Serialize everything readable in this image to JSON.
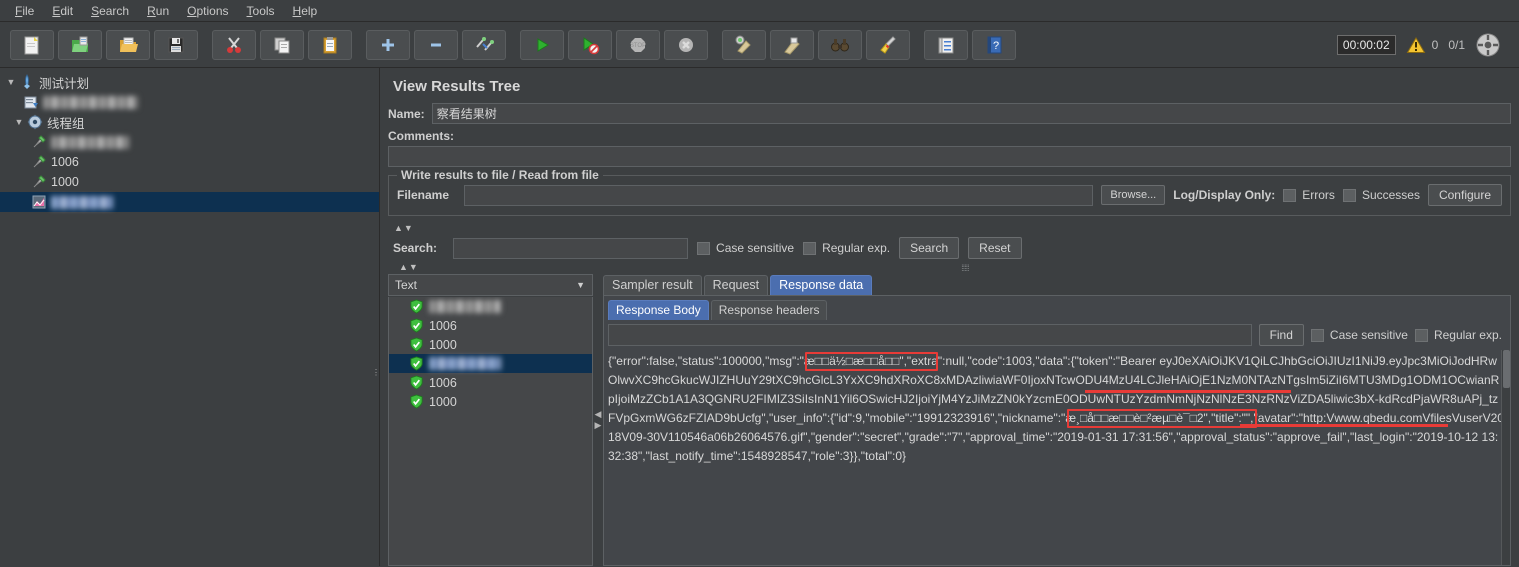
{
  "menu": {
    "items": [
      {
        "label": "File",
        "mnemonic": "F"
      },
      {
        "label": "Edit",
        "mnemonic": "E"
      },
      {
        "label": "Search",
        "mnemonic": "S"
      },
      {
        "label": "Run",
        "mnemonic": "R"
      },
      {
        "label": "Options",
        "mnemonic": "O"
      },
      {
        "label": "Tools",
        "mnemonic": "T"
      },
      {
        "label": "Help",
        "mnemonic": "H"
      }
    ]
  },
  "toolbar": {
    "buttons": [
      {
        "name": "new-test-plan-icon",
        "title": "New"
      },
      {
        "name": "templates-icon",
        "title": "Templates"
      },
      {
        "name": "open-folder-icon",
        "title": "Open"
      },
      {
        "name": "save-icon",
        "title": "Save"
      },
      {
        "name": "cut-scissors-icon",
        "title": "Cut"
      },
      {
        "name": "copy-icon",
        "title": "Copy"
      },
      {
        "name": "paste-clipboard-icon",
        "title": "Paste"
      },
      {
        "name": "expand-all-plus-icon",
        "title": "Expand all"
      },
      {
        "name": "collapse-all-minus-icon",
        "title": "Collapse all"
      },
      {
        "name": "toggle-icon",
        "title": "Toggle"
      },
      {
        "name": "start-play-icon",
        "title": "Start"
      },
      {
        "name": "start-no-pauses-icon",
        "title": "Start no pauses"
      },
      {
        "name": "stop-icon",
        "title": "Stop"
      },
      {
        "name": "shutdown-icon",
        "title": "Shutdown"
      },
      {
        "name": "clear-icon",
        "title": "Clear"
      },
      {
        "name": "clear-all-icon",
        "title": "Clear all"
      },
      {
        "name": "search-binoculars-icon",
        "title": "Search"
      },
      {
        "name": "reset-search-broom-icon",
        "title": "Reset Search"
      },
      {
        "name": "function-helper-icon",
        "title": "Function Helper Dialog"
      },
      {
        "name": "help-book-icon",
        "title": "Help"
      }
    ],
    "elapsed_time": "00:00:02",
    "warning_count": "0",
    "threads_running": "0/1"
  },
  "tree": {
    "items": [
      {
        "label": "测试计划",
        "icon": "test-plan-icon",
        "indent": 0,
        "toggle": "▼",
        "blurred": false,
        "selected": false
      },
      {
        "label": "",
        "icon": "http-header-manager-icon",
        "indent": 1,
        "toggle": "",
        "blurred": true,
        "blur_width": 95,
        "selected": false
      },
      {
        "label": "线程组",
        "icon": "thread-group-icon",
        "indent": 0,
        "toggle": "▼",
        "blurred": false,
        "selected": false
      },
      {
        "label": "",
        "icon": "http-sampler-icon",
        "indent": 1,
        "toggle": "",
        "blurred": true,
        "blur_width": 80,
        "selected": false
      },
      {
        "label": "1006",
        "icon": "http-sampler-icon",
        "indent": 1,
        "toggle": "",
        "blurred": false,
        "selected": false
      },
      {
        "label": "1000",
        "icon": "http-sampler-icon",
        "indent": 1,
        "toggle": "",
        "blurred": false,
        "selected": false
      },
      {
        "label": "",
        "icon": "view-results-tree-icon",
        "indent": 1,
        "toggle": "",
        "blurred": true,
        "blur_width": 62,
        "selected": true
      }
    ]
  },
  "panel": {
    "title": "View Results Tree",
    "name_label": "Name:",
    "name_value": "察看结果树",
    "comments_label": "Comments:",
    "comments_value": "",
    "file_group_title": "Write results to file / Read from file",
    "filename_label": "Filename",
    "filename_value": "",
    "browse_label": "Browse...",
    "log_display_only_label": "Log/Display Only:",
    "errors_label": "Errors",
    "errors_checked": false,
    "successes_label": "Successes",
    "successes_checked": false,
    "configure_label": "Configure"
  },
  "search": {
    "label": "Search:",
    "value": "",
    "case_sensitive_label": "Case sensitive",
    "case_sensitive_checked": false,
    "regular_exp_label": "Regular exp.",
    "regular_exp_checked": false,
    "search_button": "Search",
    "reset_button": "Reset"
  },
  "results": {
    "render_selector_value": "Text",
    "render_selector_arrow": "▼",
    "rows": [
      {
        "label": "",
        "blurred": true,
        "blur_width": 72,
        "status": "success",
        "selected": false
      },
      {
        "label": "1006",
        "blurred": false,
        "status": "success",
        "selected": false
      },
      {
        "label": "1000",
        "blurred": false,
        "status": "success",
        "selected": false
      },
      {
        "label": "",
        "blurred": true,
        "blur_width": 72,
        "status": "success",
        "selected": true
      },
      {
        "label": "1006",
        "blurred": false,
        "status": "success",
        "selected": false
      },
      {
        "label": "1000",
        "blurred": false,
        "status": "success",
        "selected": false
      }
    ]
  },
  "tabs": {
    "main": [
      {
        "label": "Sampler result",
        "active": false
      },
      {
        "label": "Request",
        "active": false
      },
      {
        "label": "Response data",
        "active": true
      }
    ],
    "sub": [
      {
        "label": "Response Body",
        "active": true
      },
      {
        "label": "Response headers",
        "active": false
      }
    ]
  },
  "find": {
    "value": "",
    "find_button": "Find",
    "case_sensitive_label": "Case sensitive",
    "case_sensitive_checked": false,
    "regular_exp_label": "Regular exp.",
    "regular_exp_checked": false
  },
  "response": {
    "body": "{\"error\":false,\"status\":100000,\"msg\":\"æ□□ä½□æ□□å□□\",\"extra\":null,\"code\":1003,\"data\":{\"token\":\"Bearer eyJ0eXAiOiJKV1QiLCJhbGciOiJIUzI1NiJ9.eyJpc3MiOiJodHRwOlwvXC9hcGkucWJIZHUuY29tXC9hcGlcL3YxXC9hdXRoXC8xMDAzliwiaWF0IjoxNTcwODU4MzU4LCJleHAiOjE1NzM0NTAzNTgsIm5iZiI6MTU3MDg1ODM1OCwianRpIjoiMzZCb1A1A3QGNRU2FIMIZ3SiIsInN1Yil6OSwicHJ2IjoiYjM4YzJiMzZN0kYzcmE0ODUwNTUzYzdmNmNjNzNlNzE3NzRNzViZDA5liwic3bX-kdRcdPjaWR8uAPj_tzFVpGxmWG6zFZIAD9bUcfg\",\"user_info\":{\"id\":9,\"mobile\":\"19912323916\",\"nickname\":\"æ¸□å□□æ□□è□²æµ□è¯□2\",\"title\":\"\",\"avatar\":\"http:Vwww.qbedu.comVfilesVuserV2018V09-30V110546a06b26064576.gif\",\"gender\":\"secret\",\"grade\":\"7\",\"approval_time\":\"2019-01-31 17:31:56\",\"approval_status\":\"approve_fail\",\"last_login\":\"2019-10-12 13:32:38\",\"last_notify_time\":1548928547,\"role\":3}},\"total\":0}"
  },
  "colors": {
    "background": "#3c3f41",
    "panel": "#43464a",
    "selection": "#0d3050",
    "tab_active": "#4b6eaf",
    "annotation": "#e83b37",
    "text": "#d4d4d4"
  }
}
